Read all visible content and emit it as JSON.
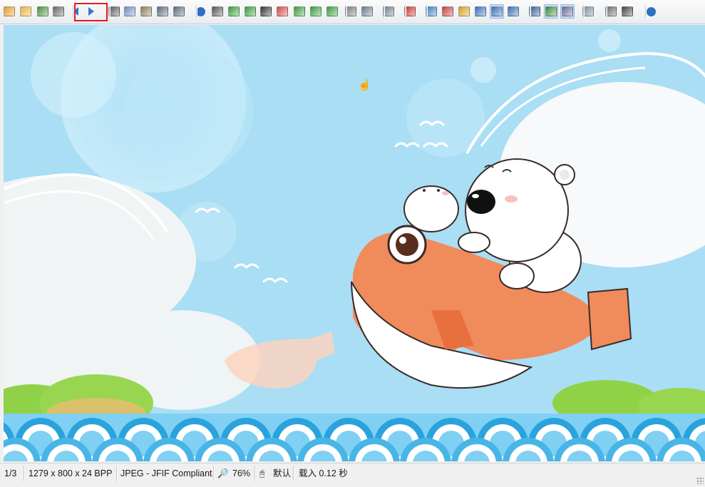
{
  "toolbar": {
    "buttons": [
      {
        "name": "thumbnails-button",
        "icon": "thumbnails-icon"
      },
      {
        "name": "open-button",
        "icon": "folder-open-icon"
      },
      {
        "name": "save-button",
        "icon": "save-icon"
      },
      {
        "name": "print-button",
        "icon": "printer-icon"
      },
      {
        "name": "previous-image-button",
        "icon": "arrow-left-icon"
      },
      {
        "name": "next-image-button",
        "icon": "arrow-right-icon"
      },
      {
        "name": "cut-button",
        "icon": "scissors-icon"
      },
      {
        "name": "copy-button",
        "icon": "copy-icon"
      },
      {
        "name": "paste-button",
        "icon": "paste-icon"
      },
      {
        "name": "undo-button",
        "icon": "undo-icon"
      },
      {
        "name": "redo-button",
        "icon": "redo-icon"
      },
      {
        "name": "info-button",
        "icon": "info-icon"
      },
      {
        "name": "capture-button",
        "icon": "camera-icon"
      },
      {
        "name": "resize-button",
        "icon": "resize-icon"
      },
      {
        "name": "download-button",
        "icon": "download-icon"
      },
      {
        "name": "grayscale-button",
        "icon": "grayscale-icon"
      },
      {
        "name": "color-balance-button",
        "icon": "color-icon"
      },
      {
        "name": "effects-button",
        "icon": "effects-icon"
      },
      {
        "name": "rotate-left-button",
        "icon": "rotate-left-icon"
      },
      {
        "name": "rotate-right-button",
        "icon": "rotate-right-icon"
      },
      {
        "name": "crop-button",
        "icon": "crop-icon"
      },
      {
        "name": "flip-horizontal-button",
        "icon": "flip-horizontal-icon"
      },
      {
        "name": "flip-vertical-button",
        "icon": "flip-vertical-icon"
      },
      {
        "name": "redeye-button",
        "icon": "redeye-icon"
      },
      {
        "name": "zoom-in-button",
        "icon": "zoom-in-icon"
      },
      {
        "name": "zoom-out-button",
        "icon": "zoom-out-icon"
      },
      {
        "name": "zoom-reset-button",
        "icon": "zoom-reset-icon"
      },
      {
        "name": "fit-window-button",
        "icon": "fit-window-icon"
      },
      {
        "name": "fit-image-button",
        "icon": "fit-image-icon"
      },
      {
        "name": "fit-width-button",
        "icon": "fit-width-icon"
      },
      {
        "name": "fullscreen-button",
        "icon": "monitor-icon"
      },
      {
        "name": "slideshow-button",
        "icon": "slideshow-icon"
      },
      {
        "name": "paint-button",
        "icon": "paint-icon"
      },
      {
        "name": "settings-button",
        "icon": "wrench-icon"
      },
      {
        "name": "batch-button",
        "icon": "batch-icon"
      },
      {
        "name": "convert-button",
        "icon": "convert-icon"
      },
      {
        "name": "help-button",
        "icon": "help-icon"
      }
    ]
  },
  "status": {
    "page": "1/3",
    "dimensions": "1279 x 800 x 24 BPP",
    "format": "JPEG - JFIF Compliant",
    "zoom": "76%",
    "mode": "默认",
    "load_time": "载入 0.12 秒"
  },
  "colors": {
    "sky": "#a9def4",
    "highlight": "#e11b22",
    "fish": "#f08b5b",
    "wave_dark": "#2aa3dc",
    "wave_light": "#7fd0f3"
  }
}
